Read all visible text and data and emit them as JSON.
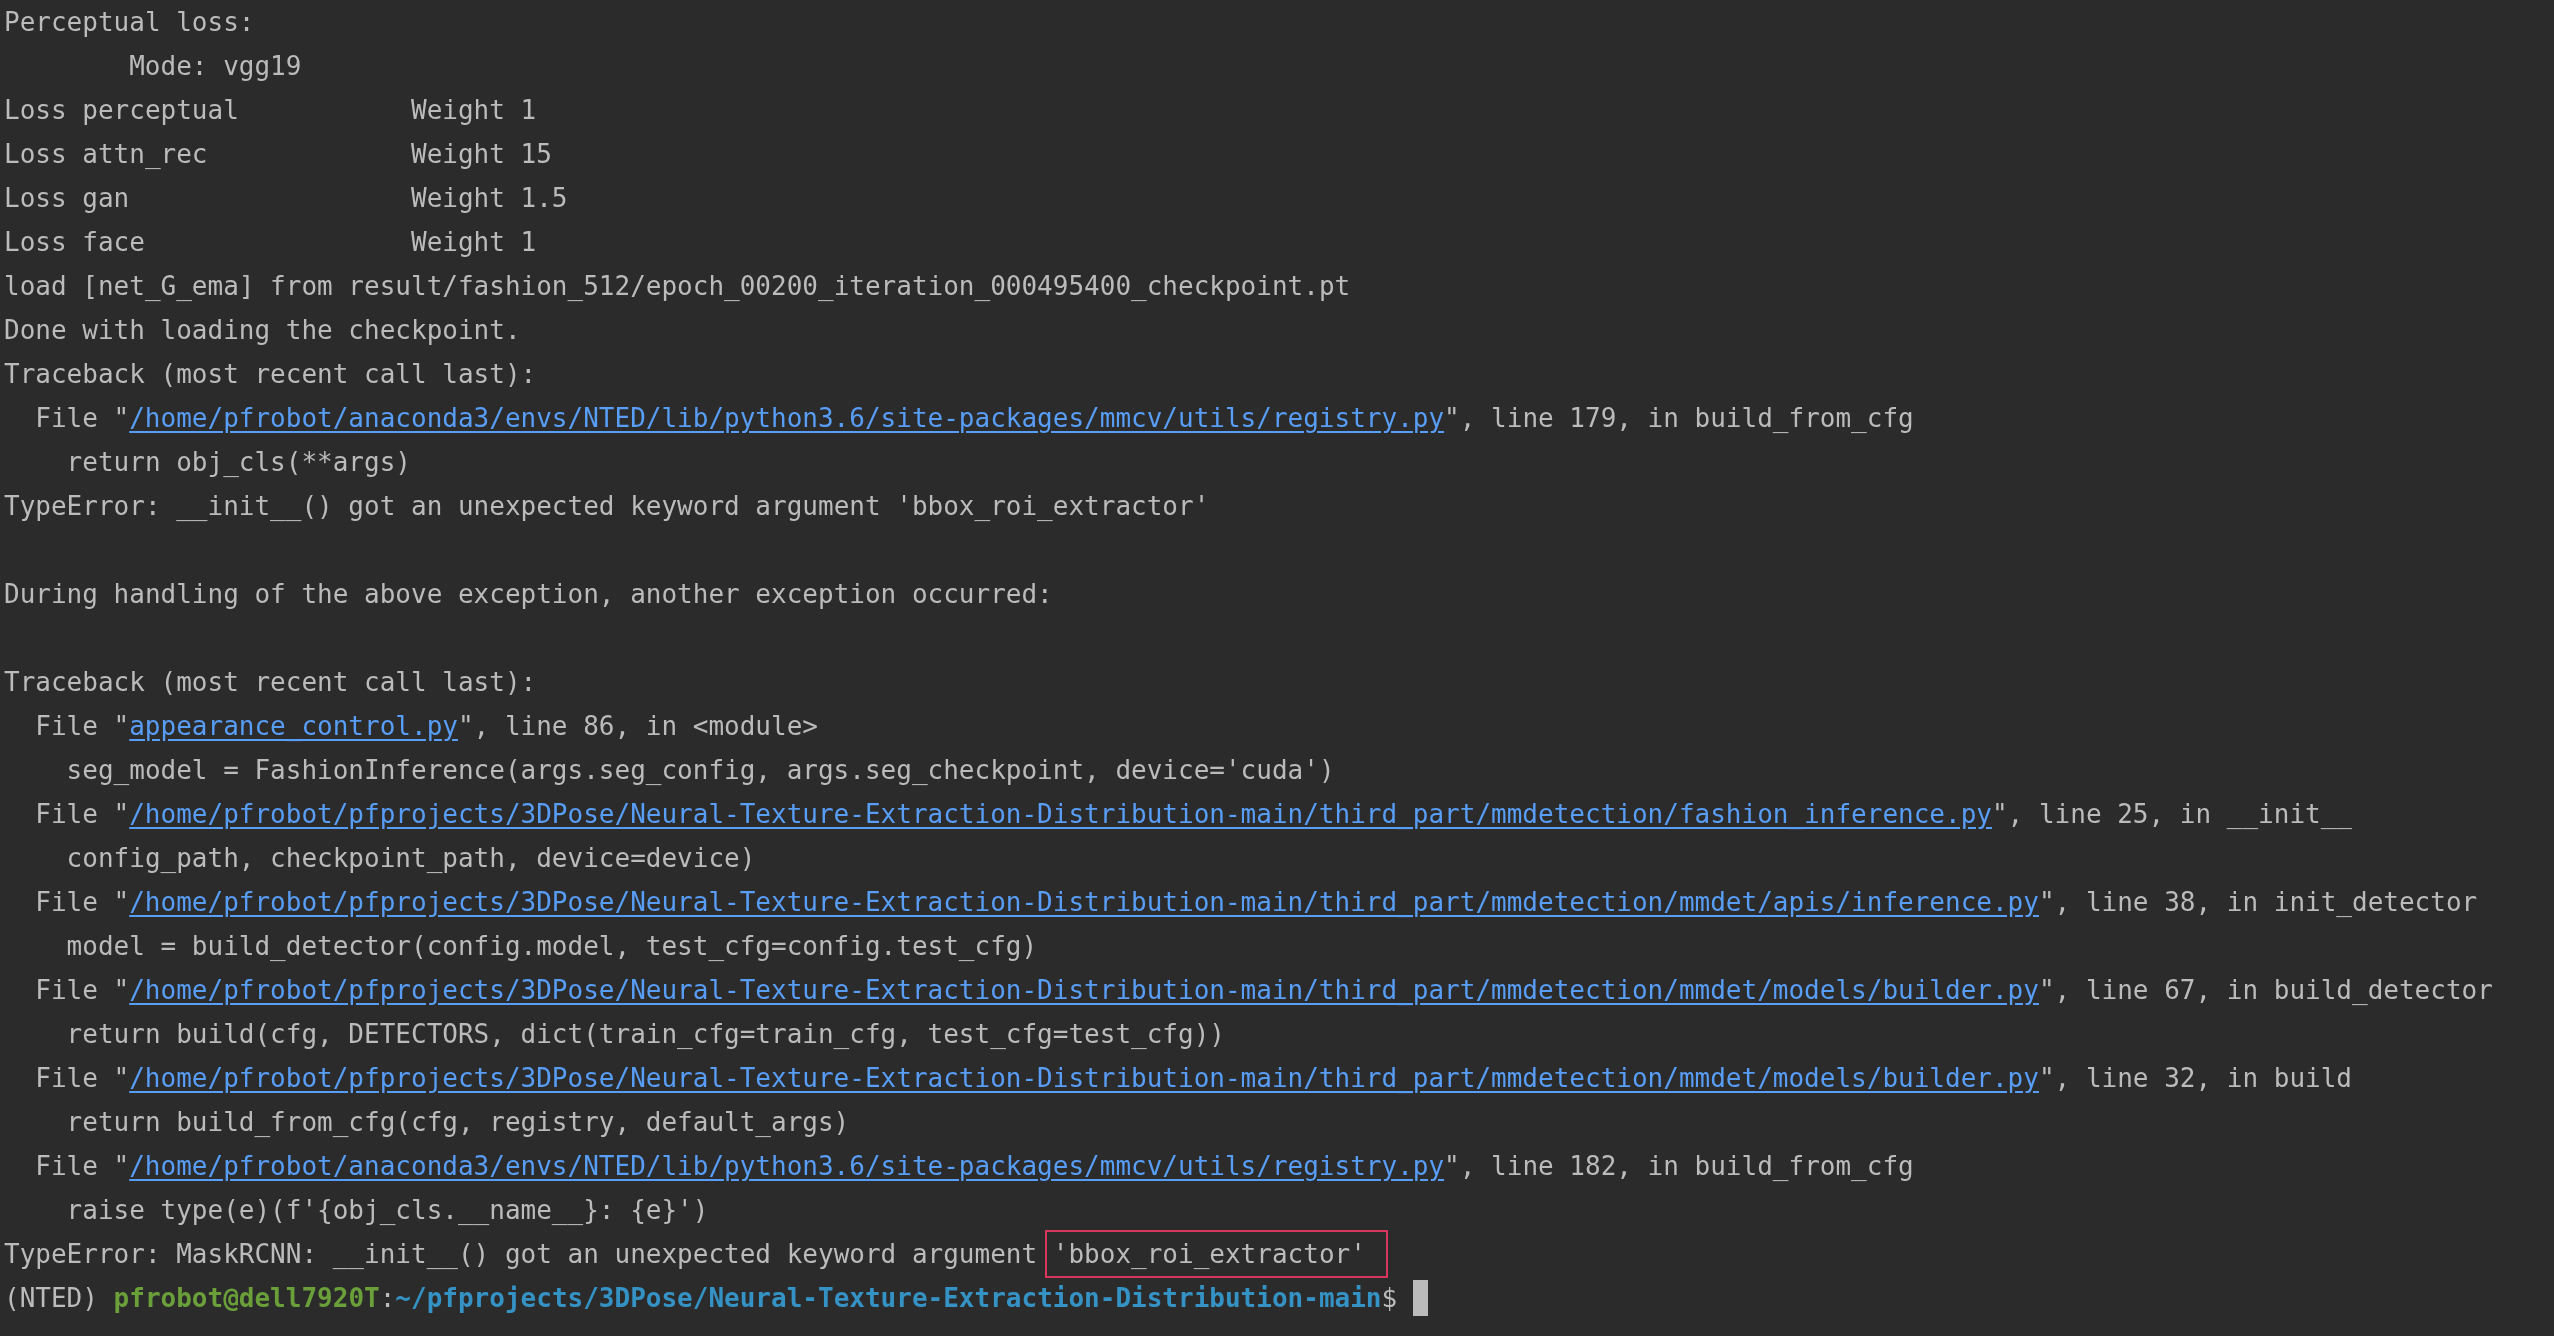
{
  "terminal": {
    "lines": [
      {
        "kind": "text",
        "text": "Perceptual loss:"
      },
      {
        "kind": "option",
        "text": "Mode: vgg19"
      },
      {
        "kind": "loss",
        "label": "Loss perceptual",
        "weight": "Weight 1"
      },
      {
        "kind": "loss",
        "label": "Loss attn_rec",
        "weight": "Weight 15"
      },
      {
        "kind": "loss",
        "label": "Loss gan",
        "weight": "Weight 1.5"
      },
      {
        "kind": "loss",
        "label": "Loss face",
        "weight": "Weight 1"
      },
      {
        "kind": "text",
        "text": "load [net_G_ema] from result/fashion_512/epoch_00200_iteration_000495400_checkpoint.pt"
      },
      {
        "kind": "text",
        "text": "Done with loading the checkpoint."
      },
      {
        "kind": "text",
        "text": "Traceback (most recent call last):"
      },
      {
        "kind": "file",
        "prefix": "File \"",
        "path": "/home/pfrobot/anaconda3/envs/NTED/lib/python3.6/site-packages/mmcv/utils/registry.py",
        "suffix": "\", line 179, in build_from_cfg"
      },
      {
        "kind": "code",
        "text": "return obj_cls(**args)"
      },
      {
        "kind": "text",
        "text": "TypeError: __init__() got an unexpected keyword argument 'bbox_roi_extractor'"
      },
      {
        "kind": "blank"
      },
      {
        "kind": "text",
        "text": "During handling of the above exception, another exception occurred:"
      },
      {
        "kind": "blank"
      },
      {
        "kind": "text",
        "text": "Traceback (most recent call last):"
      },
      {
        "kind": "file",
        "prefix": "File \"",
        "path": "appearance_control.py",
        "suffix": "\", line 86, in <module>"
      },
      {
        "kind": "code",
        "text": "seg_model = FashionInference(args.seg_config, args.seg_checkpoint, device='cuda')"
      },
      {
        "kind": "file",
        "prefix": "File \"",
        "path": "/home/pfrobot/pfprojects/3DPose/Neural-Texture-Extraction-Distribution-main/third_part/mmdetection/fashion_inference.py",
        "suffix": "\", line 25, in __init__"
      },
      {
        "kind": "code",
        "text": "config_path, checkpoint_path, device=device)"
      },
      {
        "kind": "file",
        "prefix": "File \"",
        "path": "/home/pfrobot/pfprojects/3DPose/Neural-Texture-Extraction-Distribution-main/third_part/mmdetection/mmdet/apis/inference.py",
        "suffix": "\", line 38, in init_detector"
      },
      {
        "kind": "code",
        "text": "model = build_detector(config.model, test_cfg=config.test_cfg)"
      },
      {
        "kind": "file",
        "prefix": "File \"",
        "path": "/home/pfrobot/pfprojects/3DPose/Neural-Texture-Extraction-Distribution-main/third_part/mmdetection/mmdet/models/builder.py",
        "suffix": "\", line 67, in build_detector"
      },
      {
        "kind": "code",
        "text": "return build(cfg, DETECTORS, dict(train_cfg=train_cfg, test_cfg=test_cfg))"
      },
      {
        "kind": "file",
        "prefix": "File \"",
        "path": "/home/pfrobot/pfprojects/3DPose/Neural-Texture-Extraction-Distribution-main/third_part/mmdetection/mmdet/models/builder.py",
        "suffix": "\", line 32, in build"
      },
      {
        "kind": "code",
        "text": "return build_from_cfg(cfg, registry, default_args)"
      },
      {
        "kind": "file",
        "prefix": "File \"",
        "path": "/home/pfrobot/anaconda3/envs/NTED/lib/python3.6/site-packages/mmcv/utils/registry.py",
        "suffix": "\", line 182, in build_from_cfg"
      },
      {
        "kind": "code",
        "text": "raise type(e)(f'{obj_cls.__name__}: {e}')"
      },
      {
        "kind": "error_highlight",
        "text": "TypeError: MaskRCNN: __init__() got an unexpected keyword argument ",
        "highlighted": "'bbox_roi_extractor'"
      },
      {
        "kind": "prompt",
        "env": "(NTED) ",
        "user": "pfrobot@dell7920T",
        "separator": ":",
        "path": "~/pfprojects/3DPose/Neural-Texture-Extraction-Distribution-main",
        "symbol": "$ "
      }
    ]
  }
}
